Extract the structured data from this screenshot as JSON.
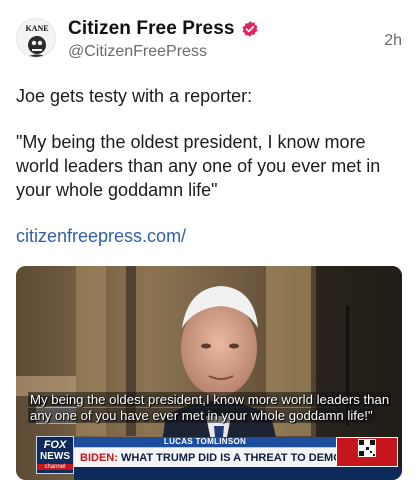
{
  "post": {
    "author": {
      "display_name": "Citizen Free Press",
      "handle": "@CitizenFreePress",
      "avatar_text": "KANE",
      "verified_color": "#e0245e"
    },
    "time": "2h",
    "body_line1": "Joe gets testy with a reporter:",
    "body_quote": "\"My being the oldest president, I know more world leaders than any one of you ever met in your whole goddamn life\"",
    "link_text": "citizenfreepress.com/",
    "media": {
      "caption_line1": "My being the oldest president,I know more world leaders than",
      "caption_line2": "any one of you have ever met in your whole goddamn life!\"",
      "network_top": "FOX",
      "network_bottom": "NEWS",
      "network_sub": "channel",
      "reporter_name": "LUCAS TOMLINSON",
      "headline_prefix": "BIDEN:",
      "headline_rest": " WHAT TRUMP DID IS A THREAT TO DEMOCRACY"
    }
  },
  "colors": {
    "link": "#2f5fa8",
    "fox_blue": "#0e2a5a",
    "fox_red": "#c4161c"
  }
}
